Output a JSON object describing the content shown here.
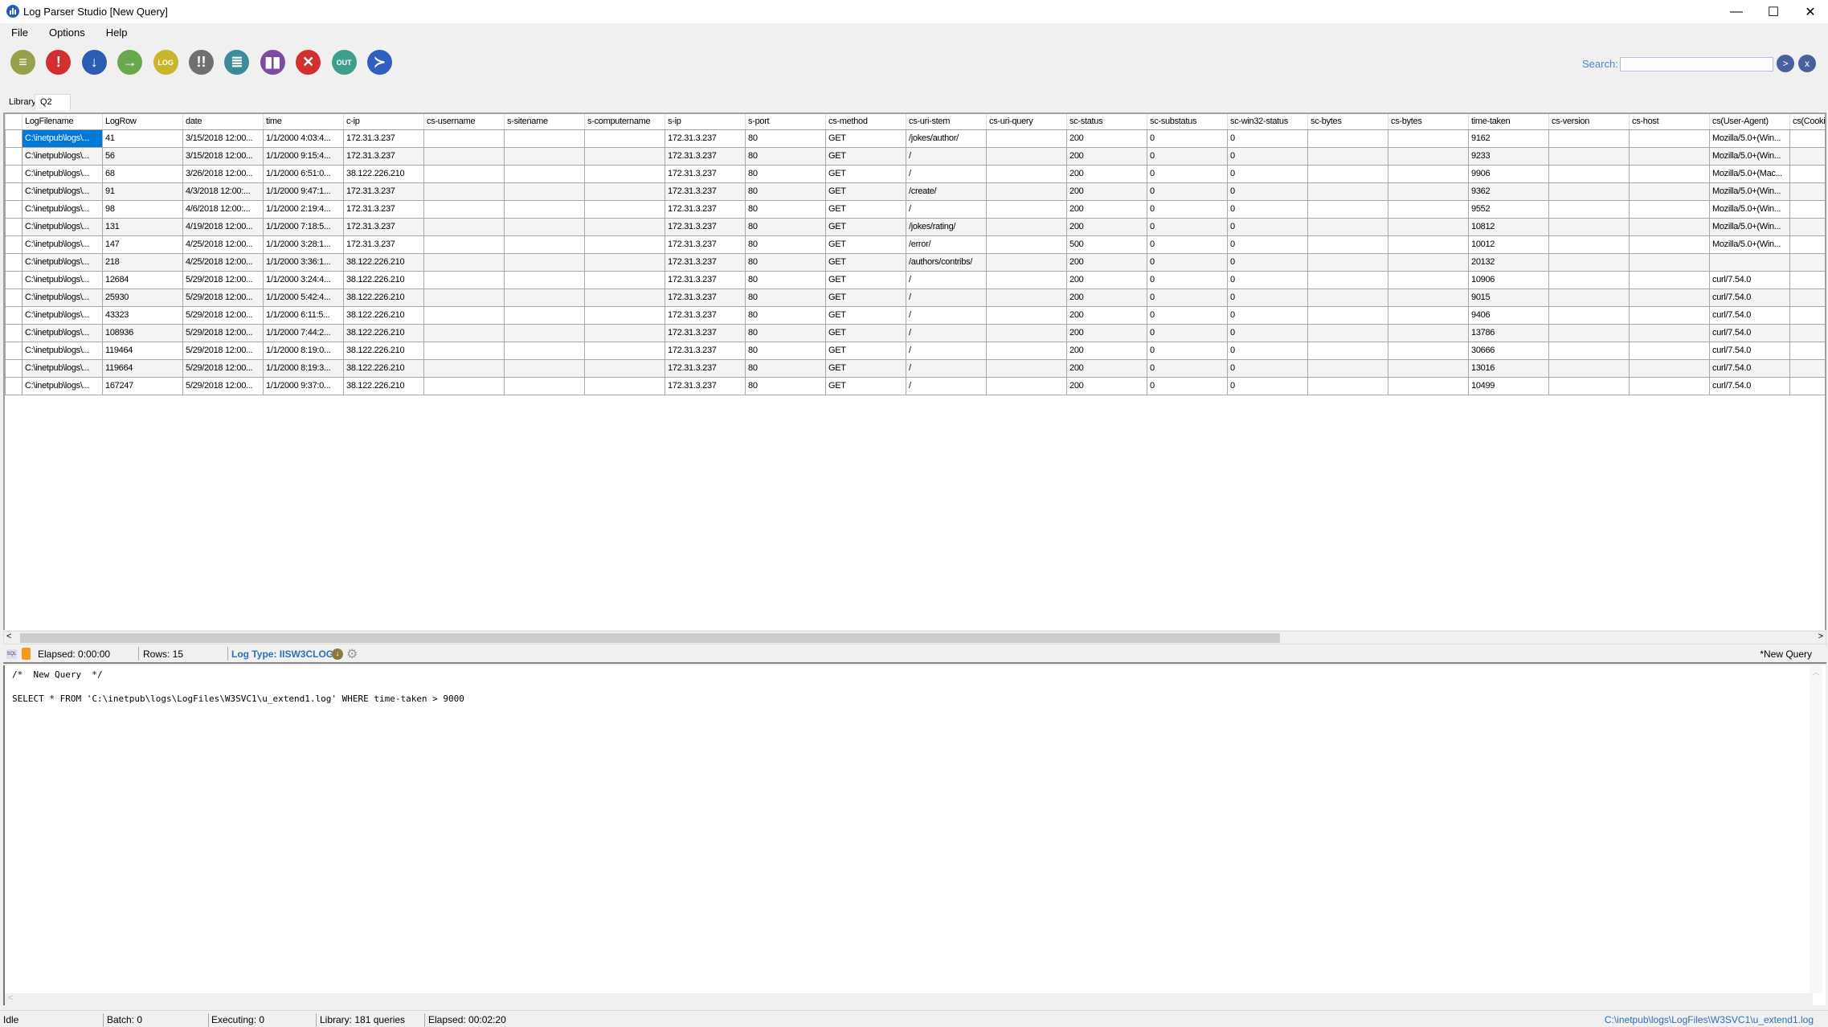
{
  "window": {
    "title": "Log Parser Studio  [New Query]",
    "minimize": "—",
    "maximize": "☐",
    "close": "✕"
  },
  "menu": [
    "File",
    "Options",
    "Help"
  ],
  "toolbar": [
    {
      "name": "new-query",
      "glyph": "≡",
      "color": "#97a14b"
    },
    {
      "name": "execute",
      "glyph": "!",
      "color": "#d32f2f"
    },
    {
      "name": "download",
      "glyph": "↓",
      "color": "#2a5db0"
    },
    {
      "name": "run-next",
      "glyph": "→",
      "color": "#6aa84f"
    },
    {
      "name": "open-log",
      "glyph": "LOG",
      "color": "#c9b52b"
    },
    {
      "name": "batch-execute",
      "glyph": "!!",
      "color": "#707070"
    },
    {
      "name": "document",
      "glyph": "≣",
      "color": "#3d8a9a"
    },
    {
      "name": "chart",
      "glyph": "▮▮",
      "color": "#7e4aa0"
    },
    {
      "name": "stop",
      "glyph": "✕",
      "color": "#d32f2f"
    },
    {
      "name": "output",
      "glyph": "OUT",
      "color": "#3e9e8e"
    },
    {
      "name": "powershell",
      "glyph": "≻",
      "color": "#2f5fbf"
    }
  ],
  "search": {
    "label": "Search:",
    "value": "",
    "go": ">",
    "clear": "x"
  },
  "tabs": [
    "Library",
    "Q2"
  ],
  "grid": {
    "columns": [
      "LogFilename",
      "LogRow",
      "date",
      "time",
      "c-ip",
      "cs-username",
      "s-sitename",
      "s-computername",
      "s-ip",
      "s-port",
      "cs-method",
      "cs-uri-stem",
      "cs-uri-query",
      "sc-status",
      "sc-substatus",
      "sc-win32-status",
      "sc-bytes",
      "cs-bytes",
      "time-taken",
      "cs-version",
      "cs-host",
      "cs(User-Agent)",
      "cs(Cookie)"
    ],
    "rows": [
      [
        "C:\\inetpub\\logs\\...",
        "41",
        "3/15/2018 12:00...",
        "1/1/2000 4:03:4...",
        "172.31.3.237",
        "",
        "",
        "",
        "172.31.3.237",
        "80",
        "GET",
        "/jokes/author/",
        "",
        "200",
        "0",
        "0",
        "",
        "",
        "9162",
        "",
        "",
        "Mozilla/5.0+(Win...",
        ""
      ],
      [
        "C:\\inetpub\\logs\\...",
        "56",
        "3/15/2018 12:00...",
        "1/1/2000 9:15:4...",
        "172.31.3.237",
        "",
        "",
        "",
        "172.31.3.237",
        "80",
        "GET",
        "/",
        "",
        "200",
        "0",
        "0",
        "",
        "",
        "9233",
        "",
        "",
        "Mozilla/5.0+(Win...",
        ""
      ],
      [
        "C:\\inetpub\\logs\\...",
        "68",
        "3/26/2018 12:00...",
        "1/1/2000 6:51:0...",
        "38.122.226.210",
        "",
        "",
        "",
        "172.31.3.237",
        "80",
        "GET",
        "/",
        "",
        "200",
        "0",
        "0",
        "",
        "",
        "9906",
        "",
        "",
        "Mozilla/5.0+(Mac...",
        ""
      ],
      [
        "C:\\inetpub\\logs\\...",
        "91",
        "4/3/2018 12:00:...",
        "1/1/2000 9:47:1...",
        "172.31.3.237",
        "",
        "",
        "",
        "172.31.3.237",
        "80",
        "GET",
        "/create/",
        "",
        "200",
        "0",
        "0",
        "",
        "",
        "9362",
        "",
        "",
        "Mozilla/5.0+(Win...",
        ""
      ],
      [
        "C:\\inetpub\\logs\\...",
        "98",
        "4/6/2018 12:00:...",
        "1/1/2000 2:19:4...",
        "172.31.3.237",
        "",
        "",
        "",
        "172.31.3.237",
        "80",
        "GET",
        "/",
        "",
        "200",
        "0",
        "0",
        "",
        "",
        "9552",
        "",
        "",
        "Mozilla/5.0+(Win...",
        ""
      ],
      [
        "C:\\inetpub\\logs\\...",
        "131",
        "4/19/2018 12:00...",
        "1/1/2000 7:18:5...",
        "172.31.3.237",
        "",
        "",
        "",
        "172.31.3.237",
        "80",
        "GET",
        "/jokes/rating/",
        "",
        "200",
        "0",
        "0",
        "",
        "",
        "10812",
        "",
        "",
        "Mozilla/5.0+(Win...",
        ""
      ],
      [
        "C:\\inetpub\\logs\\...",
        "147",
        "4/25/2018 12:00...",
        "1/1/2000 3:28:1...",
        "172.31.3.237",
        "",
        "",
        "",
        "172.31.3.237",
        "80",
        "GET",
        "/error/",
        "",
        "500",
        "0",
        "0",
        "",
        "",
        "10012",
        "",
        "",
        "Mozilla/5.0+(Win...",
        ""
      ],
      [
        "C:\\inetpub\\logs\\...",
        "218",
        "4/25/2018 12:00...",
        "1/1/2000 3:36:1...",
        "38.122.226.210",
        "",
        "",
        "",
        "172.31.3.237",
        "80",
        "GET",
        "/authors/contribs/",
        "",
        "200",
        "0",
        "0",
        "",
        "",
        "20132",
        "",
        "",
        "",
        ""
      ],
      [
        "C:\\inetpub\\logs\\...",
        "12684",
        "5/29/2018 12:00...",
        "1/1/2000 3:24:4...",
        "38.122.226.210",
        "",
        "",
        "",
        "172.31.3.237",
        "80",
        "GET",
        "/",
        "",
        "200",
        "0",
        "0",
        "",
        "",
        "10906",
        "",
        "",
        "curl/7.54.0",
        ""
      ],
      [
        "C:\\inetpub\\logs\\...",
        "25930",
        "5/29/2018 12:00...",
        "1/1/2000 5:42:4...",
        "38.122.226.210",
        "",
        "",
        "",
        "172.31.3.237",
        "80",
        "GET",
        "/",
        "",
        "200",
        "0",
        "0",
        "",
        "",
        "9015",
        "",
        "",
        "curl/7.54.0",
        ""
      ],
      [
        "C:\\inetpub\\logs\\...",
        "43323",
        "5/29/2018 12:00...",
        "1/1/2000 6:11:5...",
        "38.122.226.210",
        "",
        "",
        "",
        "172.31.3.237",
        "80",
        "GET",
        "/",
        "",
        "200",
        "0",
        "0",
        "",
        "",
        "9406",
        "",
        "",
        "curl/7.54.0",
        ""
      ],
      [
        "C:\\inetpub\\logs\\...",
        "108936",
        "5/29/2018 12:00...",
        "1/1/2000 7:44:2...",
        "38.122.226.210",
        "",
        "",
        "",
        "172.31.3.237",
        "80",
        "GET",
        "/",
        "",
        "200",
        "0",
        "0",
        "",
        "",
        "13786",
        "",
        "",
        "curl/7.54.0",
        ""
      ],
      [
        "C:\\inetpub\\logs\\...",
        "119464",
        "5/29/2018 12:00...",
        "1/1/2000 8:19:0...",
        "38.122.226.210",
        "",
        "",
        "",
        "172.31.3.237",
        "80",
        "GET",
        "/",
        "",
        "200",
        "0",
        "0",
        "",
        "",
        "30666",
        "",
        "",
        "curl/7.54.0",
        ""
      ],
      [
        "C:\\inetpub\\logs\\...",
        "119664",
        "5/29/2018 12:00...",
        "1/1/2000 8:19:3...",
        "38.122.226.210",
        "",
        "",
        "",
        "172.31.3.237",
        "80",
        "GET",
        "/",
        "",
        "200",
        "0",
        "0",
        "",
        "",
        "13016",
        "",
        "",
        "curl/7.54.0",
        ""
      ],
      [
        "C:\\inetpub\\logs\\...",
        "167247",
        "5/29/2018 12:00...",
        "1/1/2000 9:37:0...",
        "38.122.226.210",
        "",
        "",
        "",
        "172.31.3.237",
        "80",
        "GET",
        "/",
        "",
        "200",
        "0",
        "0",
        "",
        "",
        "10499",
        "",
        "",
        "curl/7.54.0",
        ""
      ]
    ]
  },
  "query_status": {
    "sql_icon": "SQL",
    "elapsed": "Elapsed: 0:00:00",
    "rows": "Rows: 15",
    "log_type": "Log Type: IISW3CLOG",
    "query_name": "*New Query"
  },
  "editor": {
    "text": "/*  New Query  */\n\nSELECT * FROM 'C:\\inetpub\\logs\\LogFiles\\W3SVC1\\u_extend1.log' WHERE time-taken > 9000"
  },
  "statusbar": {
    "state": "Idle",
    "batch": "Batch: 0",
    "executing": "Executing: 0",
    "library": "Library: 181 queries",
    "elapsed": "Elapsed: 00:02:20",
    "log_path": "C:\\inetpub\\logs\\LogFiles\\W3SVC1\\u_extend1.log"
  }
}
